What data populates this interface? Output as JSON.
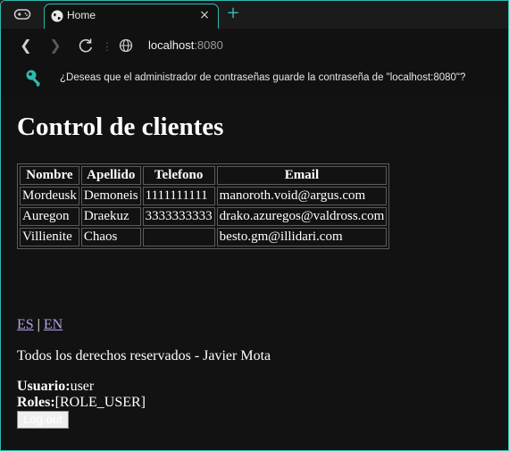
{
  "browser": {
    "tab_title": "Home",
    "url_host": "localhost",
    "url_port": ":8080",
    "new_tab": "+",
    "close": "×",
    "accent_color": "#2fb8b0"
  },
  "infobar": {
    "text": "¿Deseas que el administrador de contraseñas guarde la contraseña de \"localhost:8080\"?",
    "icon": "key-icon"
  },
  "page": {
    "title": "Control de clientes",
    "table": {
      "headers": [
        "Nombre",
        "Apellido",
        "Telefono",
        "Email"
      ],
      "rows": [
        [
          "Mordeusk",
          "Demoneis",
          "1111111111",
          "manoroth.void@argus.com"
        ],
        [
          "Auregon",
          "Draekuz",
          "3333333333",
          "drako.azuregos@valdross.com"
        ],
        [
          "Villienite",
          "Chaos",
          "",
          "besto.gm@illidari.com"
        ]
      ]
    },
    "lang": {
      "es": "ES",
      "separator": " | ",
      "en": "EN"
    },
    "rights": "Todos los derechos reservados - Javier Mota",
    "user_label": "Usuario:",
    "user_value": "user",
    "roles_label": "Roles:",
    "roles_value": "[ROLE_USER]",
    "logout_label": "Log out"
  }
}
